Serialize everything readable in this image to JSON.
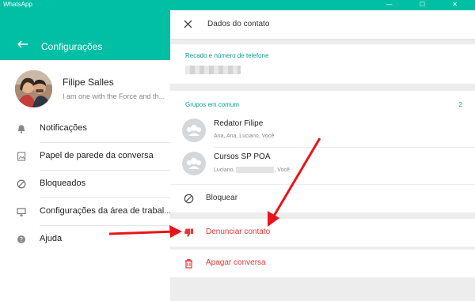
{
  "window": {
    "title": "WhatsApp",
    "controls": "— ☐ ✕"
  },
  "sidebar": {
    "title": "Configurações",
    "profile": {
      "name": "Filipe Salles",
      "status": "I am one with the Force and th..."
    },
    "items": [
      {
        "label": "Notificações",
        "icon": "bell-icon"
      },
      {
        "label": "Papel de parede da conversa",
        "icon": "wallpaper-icon"
      },
      {
        "label": "Bloqueados",
        "icon": "blocked-icon"
      },
      {
        "label": "Configurações da área de trabal...",
        "icon": "desktop-icon"
      },
      {
        "label": "Ajuda",
        "icon": "help-icon"
      }
    ]
  },
  "contact": {
    "title": "Dados do contato",
    "phone_section": "Recado e número de telefone",
    "groups_section": "Grupos em comum",
    "groups_count": "2",
    "groups": [
      {
        "name": "Redator Filipe",
        "members": "Ana, Ana, Luciano, Você"
      },
      {
        "name": "Cursos SP POA",
        "members_prefix": "Luciano,",
        "members_suffix": ", Você"
      }
    ],
    "actions": {
      "block": "Bloquear",
      "report": "Denunciar contato",
      "delete": "Apagar conversa"
    }
  },
  "colors": {
    "accent": "#00bfa5",
    "danger": "#e53935",
    "arrow": "#e8141b"
  }
}
